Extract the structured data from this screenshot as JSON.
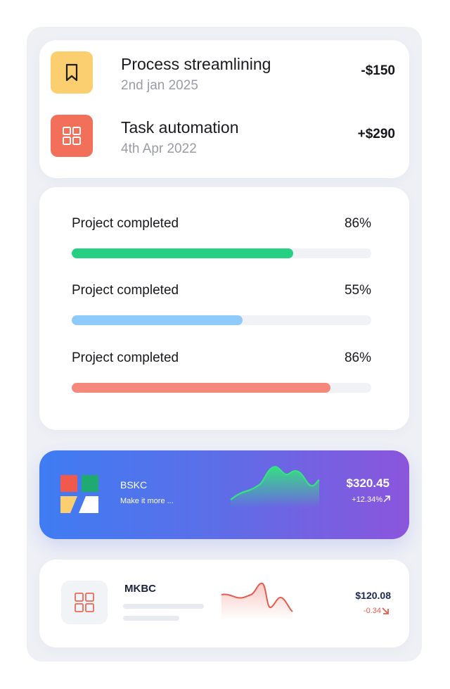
{
  "transactions": [
    {
      "title": "Process streamlining",
      "date": "2nd jan 2025",
      "amount": "-$150",
      "icon": "bookmark-icon",
      "icon_bg": "#fbcf6f"
    },
    {
      "title": "Task automation",
      "date": "4th Apr 2022",
      "amount": "+$290",
      "icon": "grid-icon",
      "icon_bg": "#f26f5a"
    }
  ],
  "progress": [
    {
      "label": "Project completed",
      "value": "86%",
      "fill_fraction": 0.74,
      "color": "#27cf82"
    },
    {
      "label": "Project completed",
      "value": "55%",
      "fill_fraction": 0.57,
      "color": "#8ecbfa"
    },
    {
      "label": "Project completed",
      "value": "86%",
      "fill_fraction": 0.865,
      "color": "#f5877b"
    }
  ],
  "stocks": [
    {
      "name": "BSKC",
      "subtitle": "Make it more ...",
      "price": "$320.45",
      "change": "+12.34%",
      "trend": "up",
      "icon": "tangram-logo-icon"
    },
    {
      "name": "MKBC",
      "subtitle": "",
      "price": "$120.08",
      "change": "-0.34",
      "trend": "down",
      "icon": "grid-icon"
    }
  ],
  "colors": {
    "card_gradient_start": "#3f7cf3",
    "card_gradient_end": "#8b55dc",
    "sparkline_up": "#33e57e",
    "sparkline_down": "#e8594e",
    "negative": "#ea5b4b"
  }
}
